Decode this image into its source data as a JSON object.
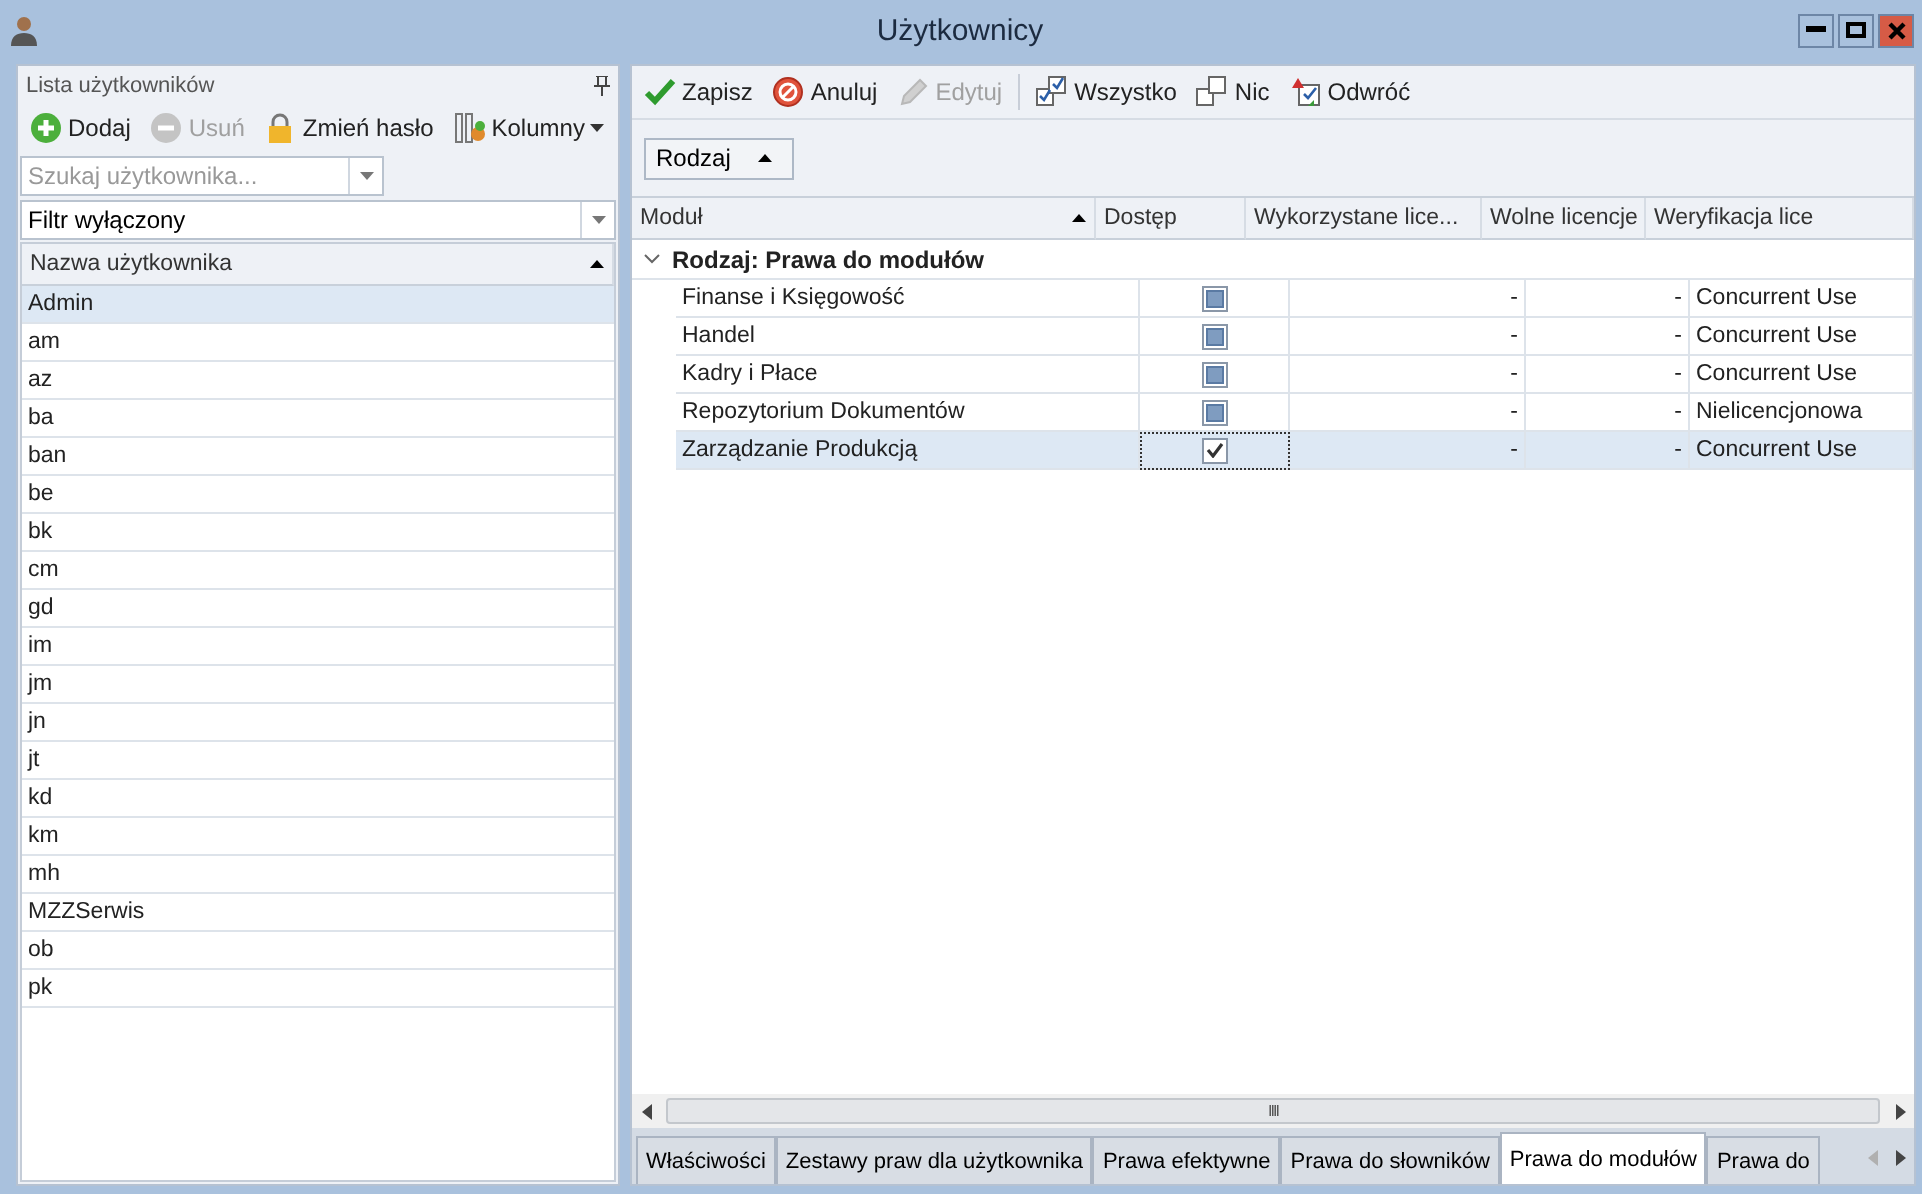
{
  "window": {
    "title": "Użytkownicy"
  },
  "left_panel": {
    "title": "Lista użytkowników",
    "toolbar": [
      {
        "label": "Dodaj",
        "disabled": false
      },
      {
        "label": "Usuń",
        "disabled": true
      },
      {
        "label": "Zmień hasło",
        "disabled": false
      },
      {
        "label": "Kolumny",
        "disabled": false,
        "dropdown": true
      }
    ],
    "search": {
      "placeholder": "Szukaj użytkownika..."
    },
    "filter": {
      "value": "Filtr wyłączony"
    },
    "column": "Nazwa użytkownika",
    "users": [
      {
        "name": "Admin",
        "selected": true
      },
      {
        "name": "am",
        "selected": false
      },
      {
        "name": "az",
        "selected": false
      },
      {
        "name": "ba",
        "selected": false
      },
      {
        "name": "ban",
        "selected": false
      },
      {
        "name": "be",
        "selected": false
      },
      {
        "name": "bk",
        "selected": false
      },
      {
        "name": "cm",
        "selected": false
      },
      {
        "name": "gd",
        "selected": false
      },
      {
        "name": "im",
        "selected": false
      },
      {
        "name": "jm",
        "selected": false
      },
      {
        "name": "jn",
        "selected": false
      },
      {
        "name": "jt",
        "selected": false
      },
      {
        "name": "kd",
        "selected": false
      },
      {
        "name": "km",
        "selected": false
      },
      {
        "name": "mh",
        "selected": false
      },
      {
        "name": "MZZSerwis",
        "selected": false
      },
      {
        "name": "ob",
        "selected": false
      },
      {
        "name": "pk",
        "selected": false
      }
    ]
  },
  "toolbar": [
    {
      "label": "Zapisz",
      "disabled": false
    },
    {
      "label": "Anuluj",
      "disabled": false
    },
    {
      "label": "Edytuj",
      "disabled": true
    },
    {
      "label": "Wszystko",
      "disabled": false
    },
    {
      "label": "Nic",
      "disabled": false
    },
    {
      "label": "Odwróć",
      "disabled": false
    }
  ],
  "group_chip": "Rodzaj",
  "table": {
    "columns": [
      "Moduł",
      "Dostęp",
      "Wykorzystane lice...",
      "Wolne licencje",
      "Weryfikacja lice"
    ],
    "group": "Rodzaj: Prawa do modułów",
    "rows": [
      {
        "module": "Finanse i Księgowość",
        "checked": false,
        "indeterminate": true,
        "used": "-",
        "free": "-",
        "verification": "Concurrent Use",
        "selected": false
      },
      {
        "module": "Handel",
        "checked": false,
        "indeterminate": true,
        "used": "-",
        "free": "-",
        "verification": "Concurrent Use",
        "selected": false
      },
      {
        "module": "Kadry i Płace",
        "checked": false,
        "indeterminate": true,
        "used": "-",
        "free": "-",
        "verification": "Concurrent Use",
        "selected": false
      },
      {
        "module": "Repozytorium Dokumentów",
        "checked": false,
        "indeterminate": true,
        "used": "-",
        "free": "-",
        "verification": "Nielicencjonowa",
        "selected": false
      },
      {
        "module": "Zarządzanie Produkcją",
        "checked": true,
        "indeterminate": false,
        "used": "-",
        "free": "-",
        "verification": "Concurrent Use",
        "selected": true
      }
    ]
  },
  "scrollbar_grip": "IIII",
  "tabs": [
    {
      "label": "Właściwości",
      "selected": false
    },
    {
      "label": "Zestawy praw dla użytkownika",
      "selected": false
    },
    {
      "label": "Prawa efektywne",
      "selected": false
    },
    {
      "label": "Prawa do słowników",
      "selected": false
    },
    {
      "label": "Prawa do modułów",
      "selected": true
    },
    {
      "label": "Prawa do",
      "selected": false
    }
  ]
}
